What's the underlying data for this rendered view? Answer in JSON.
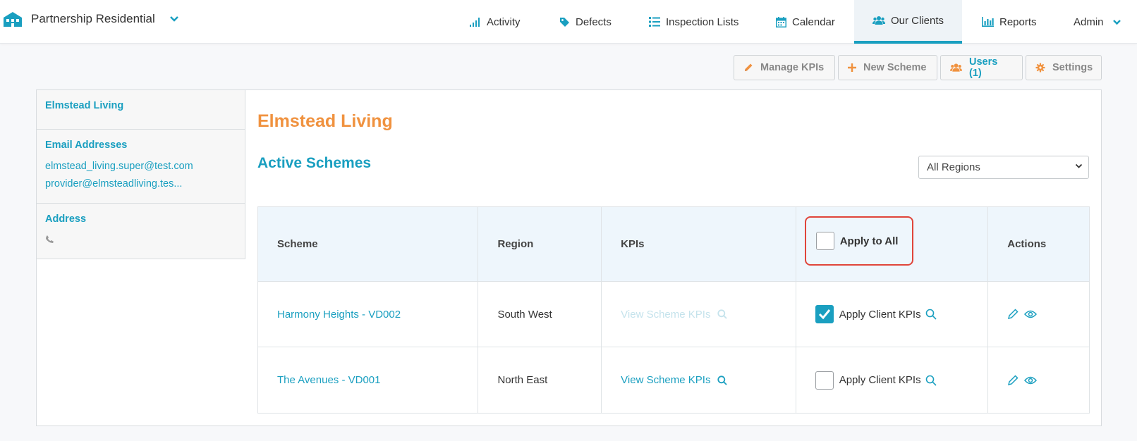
{
  "nav": {
    "brand": "Partnership Residential",
    "items": [
      {
        "label": "Activity",
        "icon": "signal-bars-icon"
      },
      {
        "label": "Defects",
        "icon": "tag-icon"
      },
      {
        "label": "Inspection Lists",
        "icon": "list-icon"
      },
      {
        "label": "Calendar",
        "icon": "calendar-icon"
      },
      {
        "label": "Our Clients",
        "icon": "users-icon",
        "active": true
      },
      {
        "label": "Reports",
        "icon": "bar-chart-icon"
      },
      {
        "label": "Admin",
        "icon": "chevron-down-icon"
      }
    ]
  },
  "toolbar": {
    "manage_kpis": "Manage KPIs",
    "new_scheme": "New Scheme",
    "users": "Users (1)",
    "settings": "Settings"
  },
  "sidebar": {
    "client_name": "Elmstead Living",
    "email_heading": "Email Addresses",
    "emails": [
      "elmstead_living.super@test.com",
      "provider@elmsteadliving.tes..."
    ],
    "address_heading": "Address"
  },
  "main": {
    "client_title": "Elmstead Living",
    "section_title": "Active Schemes",
    "region_filter": "All Regions"
  },
  "table": {
    "headers": {
      "scheme": "Scheme",
      "region": "Region",
      "kpis": "KPIs",
      "apply_all": "Apply to All",
      "actions": "Actions"
    },
    "rows": [
      {
        "scheme": "Harmony Heights - VD002",
        "region": "South West",
        "kpis": "View Scheme KPIs",
        "kpis_disabled": true,
        "apply_label": "Apply Client KPIs",
        "apply_checked": true
      },
      {
        "scheme": "The Avenues - VD001",
        "region": "North East",
        "kpis": "View Scheme KPIs",
        "kpis_disabled": false,
        "apply_label": "Apply Client KPIs",
        "apply_checked": false
      }
    ]
  },
  "colors": {
    "accent": "#1a9fc0",
    "orange": "#f0923f",
    "highlight": "#e0453a"
  }
}
